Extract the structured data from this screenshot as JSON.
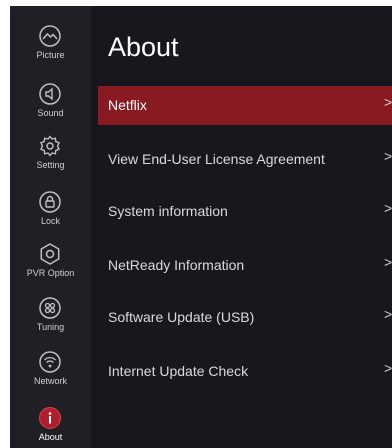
{
  "sidebar": {
    "items": [
      {
        "label": "Picture",
        "icon": "picture-icon"
      },
      {
        "label": "Sound",
        "icon": "sound-icon"
      },
      {
        "label": "Setting",
        "icon": "gear-icon"
      },
      {
        "label": "Lock",
        "icon": "lock-icon"
      },
      {
        "label": "PVR Option",
        "icon": "pvr-icon"
      },
      {
        "label": "Tuning",
        "icon": "tuning-icon"
      },
      {
        "label": "Network",
        "icon": "network-icon"
      },
      {
        "label": "About",
        "icon": "info-icon"
      }
    ],
    "active": "About"
  },
  "page": {
    "title": "About"
  },
  "menu": {
    "items": [
      {
        "label": "Netflix"
      },
      {
        "label": "View End-User License Agreement"
      },
      {
        "label": "System information"
      },
      {
        "label": "NetReady Information"
      },
      {
        "label": "Software Update (USB)"
      },
      {
        "label": "Internet Update Check"
      }
    ],
    "selected": "Netflix",
    "chevron": ">"
  },
  "colors": {
    "background": "#17171d",
    "sidebar": "#1f1f25",
    "selection": "#8a1a22",
    "active_icon": "#b01e2e"
  }
}
